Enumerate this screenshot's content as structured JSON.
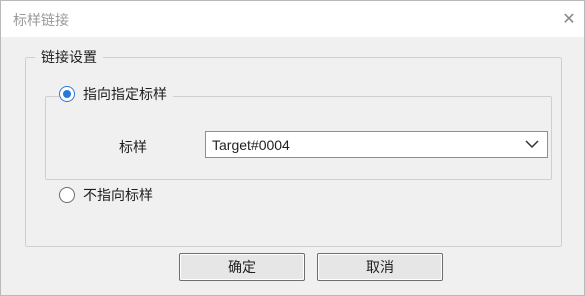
{
  "window": {
    "title": "标样链接"
  },
  "group": {
    "label": "链接设置"
  },
  "option_specific": {
    "label": "指向指定标样",
    "selected": true
  },
  "sample_field": {
    "label": "标样",
    "value": "Target#0004"
  },
  "option_none": {
    "label": "不指向标样",
    "selected": false
  },
  "buttons": {
    "ok": "确定",
    "cancel": "取消"
  },
  "icons": {
    "close": "close-icon",
    "dropdown": "chevron-down-icon",
    "radio_selected": "radio-selected-icon",
    "radio_unselected": "radio-unselected-icon"
  },
  "colors": {
    "accent": "#2b79d6"
  }
}
